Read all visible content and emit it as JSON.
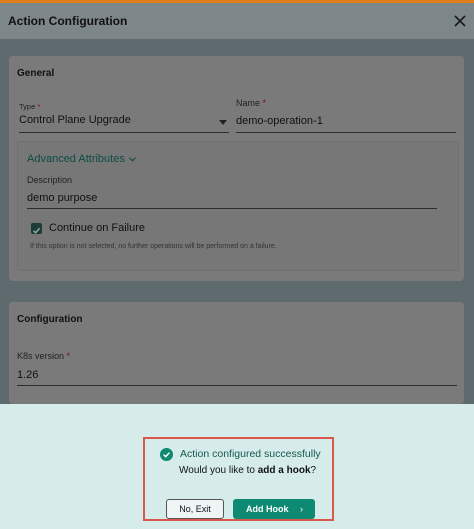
{
  "window": {
    "title": "Action Configuration",
    "close_icon": "close-icon"
  },
  "general": {
    "heading": "General",
    "type_label": "Type",
    "type_required": "*",
    "type_value": "Control Plane Upgrade",
    "name_label": "Name",
    "name_required": "*",
    "name_value": "demo-operation-1",
    "advanced": {
      "toggle_label": "Advanced Attributes",
      "description_label": "Description",
      "description_value": "demo purpose",
      "continue_label": "Continue on Failure",
      "continue_checked": true,
      "continue_hint": "If this option is not selected, no further operations will be performed on a failure."
    }
  },
  "configuration": {
    "heading": "Configuration",
    "k8s_label": "K8s version",
    "k8s_required": "*",
    "k8s_value": "1.26"
  },
  "dialog": {
    "message": "Action configured successfully",
    "question_prefix": "Would you like to",
    "question_bold": "add a hook",
    "question_suffix": "?",
    "no_exit_label": "No, Exit",
    "add_hook_label": "Add Hook",
    "add_hook_chevron": "›"
  },
  "colors": {
    "accent": "#0e8a72",
    "highlight_border": "#d9584b",
    "success_text": "#17584e"
  }
}
